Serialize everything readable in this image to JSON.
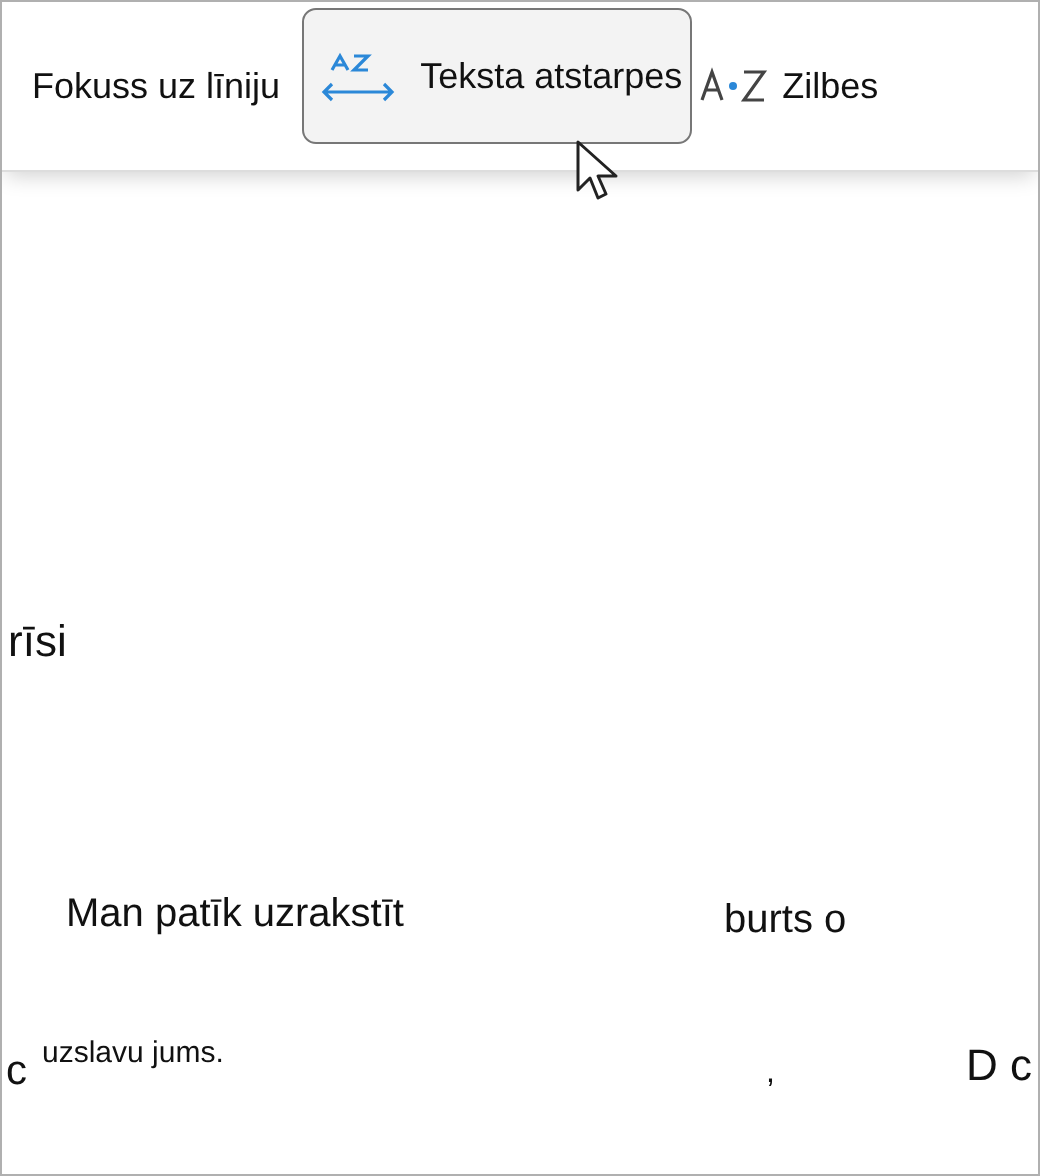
{
  "toolbar": {
    "items": [
      {
        "kind": "text",
        "label": "Fokuss uz līniju",
        "selected": false
      },
      {
        "kind": "spacing",
        "label": "Teksta atstarpes",
        "selected": true
      },
      {
        "kind": "syllables",
        "label": "Zilbes",
        "selected": false
      }
    ]
  },
  "document": {
    "fragments": [
      "rīsi",
      "Man patīk uzrakstīt",
      "burts o",
      "c",
      "uzslavu jums.",
      ",",
      "D c"
    ]
  }
}
